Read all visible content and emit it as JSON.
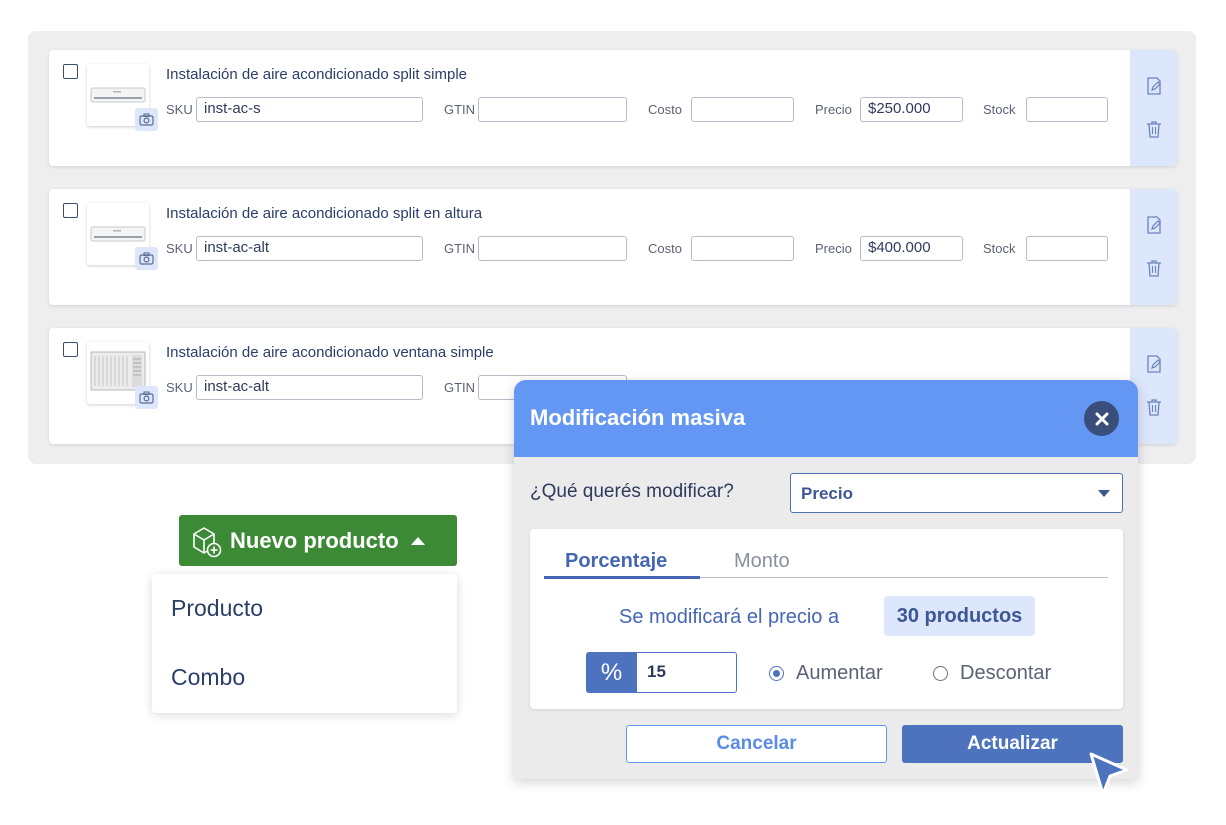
{
  "products": [
    {
      "title": "Instalación de aire acondicionado split simple",
      "sku": "inst-ac-s",
      "gtin": "",
      "costo": "",
      "precio": "$250.000",
      "stock": "",
      "image": "split-ac-image"
    },
    {
      "title": "Instalación de aire acondicionado split en altura",
      "sku": "inst-ac-alt",
      "gtin": "",
      "costo": "",
      "precio": "$400.000",
      "stock": "",
      "image": "split-ac-image"
    },
    {
      "title": "Instalación de aire acondicionado ventana simple",
      "sku": "inst-ac-alt",
      "gtin": "",
      "costo": "",
      "precio": "",
      "stock": "",
      "image": "window-ac-image"
    }
  ],
  "field_labels": {
    "sku": "SKU",
    "gtin": "GTIN",
    "costo": "Costo",
    "precio": "Precio",
    "stock": "Stock"
  },
  "new_product": {
    "label": "Nuevo producto",
    "icon": "box-plus-icon",
    "menu": [
      "Producto",
      "Combo"
    ]
  },
  "modal": {
    "title": "Modificación masiva",
    "question": "¿Qué querés modificar?",
    "select_value": "Precio",
    "tabs": [
      "Porcentaje",
      "Monto"
    ],
    "active_tab": "Porcentaje",
    "info_text": "Se modificará el precio a",
    "count": "30 productos",
    "percent_symbol": "%",
    "percent_value": "15",
    "options": [
      "Aumentar",
      "Descontar"
    ],
    "selected_option": "Aumentar",
    "cancel_label": "Cancelar",
    "update_label": "Actualizar"
  },
  "colors": {
    "header_blue": "#6497f3",
    "primary_blue": "#4d72be",
    "green": "#3c8a35",
    "side_blue": "#dde7fb"
  }
}
